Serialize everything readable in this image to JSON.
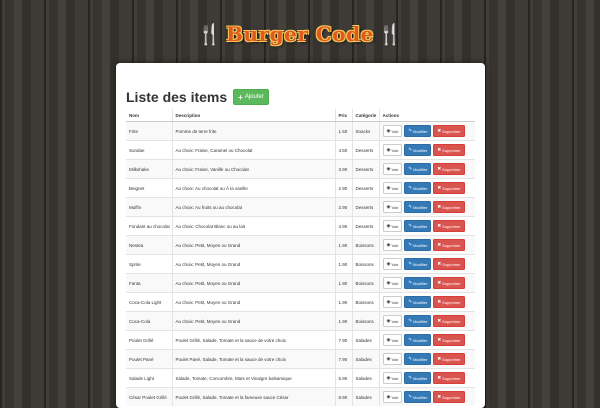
{
  "brand": {
    "name": "Burger Code",
    "utensil_icon": "🍴"
  },
  "page": {
    "title": "Liste des items",
    "add_label": "Ajouter"
  },
  "table": {
    "headers": [
      "Nom",
      "Description",
      "Prix",
      "Catégorie",
      "Actions"
    ],
    "rows": [
      {
        "name": "Frite",
        "description": "Pomme de terre frite",
        "price": "1.50",
        "category": "Snacks"
      },
      {
        "name": "Sundae",
        "description": "Au choix: Fraise, Caramel ou Chocolat",
        "price": "4.50",
        "category": "Desserts"
      },
      {
        "name": "Milkshake",
        "description": "Au choix: Fraise, Vanille ou Chocolat",
        "price": "3.90",
        "category": "Desserts"
      },
      {
        "name": "Beignet",
        "description": "Au choix: Au chocolat ou Ã  la vanille",
        "price": "2.90",
        "category": "Desserts"
      },
      {
        "name": "Muffin",
        "description": "Au choix: Au fruits ou au chocolat",
        "price": "2.90",
        "category": "Desserts"
      },
      {
        "name": "Fondant au chocolat",
        "description": "Au choix: Chocolat Blanc ou au lait",
        "price": "4.90",
        "category": "Desserts"
      },
      {
        "name": "Nestea",
        "description": "Au choix: Petit, Moyen ou Grand",
        "price": "1.90",
        "category": "Boissons"
      },
      {
        "name": "Sprite",
        "description": "Au choix: Petit, Moyen ou Grand",
        "price": "1.90",
        "category": "Boissons"
      },
      {
        "name": "Fanta",
        "description": "Au choix: Petit, Moyen ou Grand",
        "price": "1.90",
        "category": "Boissons"
      },
      {
        "name": "Coca-Cola Light",
        "description": "Au choix: Petit, Moyen ou Grand",
        "price": "1.90",
        "category": "Boissons"
      },
      {
        "name": "Coca-Cola",
        "description": "Au choix: Petit, Moyen ou Grand",
        "price": "1.90",
        "category": "Boissons"
      },
      {
        "name": "Poulet Grillé",
        "description": "Poulet Grillé, Salade, Tomate et la sauce de votre choix",
        "price": "7.90",
        "category": "Salades"
      },
      {
        "name": "Poulet Pané",
        "description": "Poulet Pané, Salade, Tomate et la sauce de votre choix",
        "price": "7.90",
        "category": "Salades"
      },
      {
        "name": "Salade Light",
        "description": "Salade, Tomate, Concombre, Maïs et Vinaigre balsamique",
        "price": "5.90",
        "category": "Salades"
      },
      {
        "name": "César Poulet Grillé",
        "description": "Poulet Grillé, Salade, Tomate et la fameuse sauce César",
        "price": "8.90",
        "category": "Salades"
      }
    ],
    "actions": {
      "view": "Voir",
      "edit": "Modifier",
      "delete": "Supprimer"
    }
  },
  "icons": {
    "add": "plus-icon",
    "view": "eye-icon",
    "edit": "pencil-icon",
    "delete": "times-icon"
  },
  "colors": {
    "brand_text": "#e05a1c",
    "add_button": "#5cb85c",
    "edit_button": "#337ab7",
    "delete_button": "#d9534f"
  }
}
